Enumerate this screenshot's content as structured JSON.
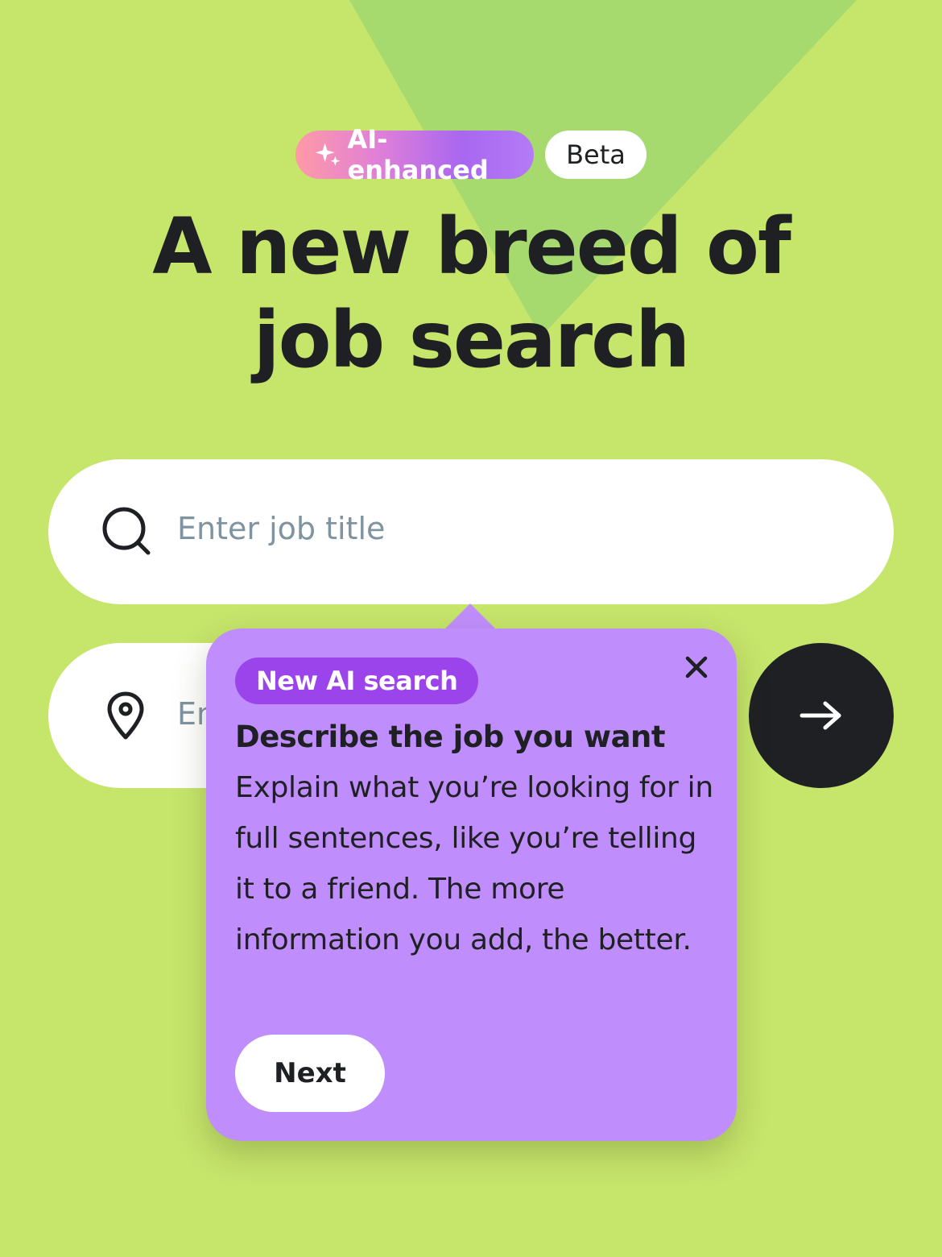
{
  "badges": {
    "ai_label": "AI-enhanced",
    "beta_label": "Beta"
  },
  "hero": {
    "title": "A new breed of job search"
  },
  "search": {
    "job_placeholder": "Enter job title",
    "job_value": "",
    "location_placeholder": "Enter location",
    "location_value": "",
    "icons": {
      "search": "search-icon",
      "location": "map-pin-icon",
      "submit": "arrow-right-icon"
    }
  },
  "popover": {
    "tag": "New AI search",
    "heading": "Describe the job you want",
    "body": "Explain what you’re looking for in full sentences, like you’re telling it to a friend. The more information you add, the better.",
    "next_label": "Next",
    "close_icon": "close-icon"
  },
  "colors": {
    "background": "#c6e56b",
    "triangle": "#a6d96e",
    "popover": "#c08efc",
    "tag": "#9b44ec",
    "dark": "#1f2024",
    "placeholder": "#7f93a0"
  }
}
